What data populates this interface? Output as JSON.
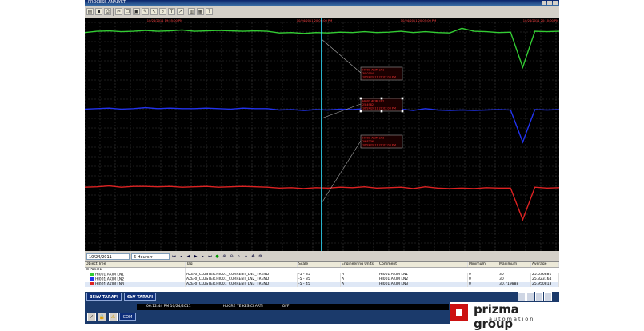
{
  "window": {
    "title": "PROCESS ANALYST"
  },
  "toolbar": {
    "icons": [
      "open-icon",
      "save-icon",
      "print-icon",
      "cut-icon",
      "copy-icon",
      "paste-icon",
      "pen-icon",
      "pointer-icon",
      "zoom-icon",
      "text-icon",
      "arrow-icon",
      "chart-icon",
      "grid-icon",
      "help-icon"
    ]
  },
  "chart": {
    "top_timestamps": [
      "10/24/2011 19:55:00 PM",
      "10/24/2011 20:00:00 PM",
      "10/24/2011 20:05:00 PM",
      "10/24/2011 20:10:00 PM"
    ],
    "cursor_labels": [
      {
        "line1": "HI001 AKIM LN1",
        "line2": "30.0704",
        "line3": "10/24/2011 20:02:00 PM"
      },
      {
        "line1": "HI001 AKIM LN2",
        "line2": "25.4982",
        "line3": "10/24/2011 20:02:00 PM"
      },
      {
        "line1": "HI001 AKIM LN3",
        "line2": "29.8236",
        "line3": "10/24/2011 20:02:00 PM"
      }
    ]
  },
  "chart_data": {
    "type": "line",
    "x": [
      0,
      1,
      2,
      3,
      4,
      5,
      6,
      7,
      8,
      9,
      10,
      11,
      12,
      13,
      14,
      15,
      16,
      17,
      18,
      19,
      20,
      21,
      22,
      23,
      24,
      25,
      26,
      27,
      28,
      29,
      30,
      31,
      32,
      33,
      34,
      35,
      36,
      37,
      38,
      39
    ],
    "series": [
      {
        "values": [
          30.6,
          30.9,
          31.0,
          30.8,
          30.9,
          31.1,
          30.9,
          31.0,
          31.2,
          30.9,
          31.0,
          31.1,
          31.0,
          30.9,
          31.0,
          30.9,
          30.5,
          30.6,
          30.4,
          30.6,
          30.5,
          30.7,
          30.6,
          30.8,
          30.6,
          30.7,
          30.9,
          30.6,
          30.8,
          30.6,
          30.5,
          31.6,
          30.9,
          30.8,
          30.6,
          30.7,
          22.4,
          30.9,
          30.8,
          30.9
        ],
        "color": "#33cc33"
      },
      {
        "values": [
          25.5,
          25.6,
          25.7,
          25.5,
          25.6,
          25.8,
          25.6,
          25.7,
          25.6,
          25.6,
          25.7,
          25.6,
          25.5,
          25.7,
          25.6,
          25.6,
          25.3,
          25.4,
          25.2,
          25.4,
          25.3,
          25.5,
          25.4,
          25.6,
          25.3,
          25.4,
          25.5,
          25.2,
          25.6,
          25.3,
          25.2,
          25.3,
          25.2,
          25.3,
          25.4,
          25.3,
          18.3,
          25.4,
          25.3,
          25.4
        ],
        "color": "#2233ee"
      },
      {
        "values": [
          30.0,
          30.1,
          30.3,
          30.0,
          30.2,
          30.2,
          30.1,
          30.2,
          30.0,
          30.1,
          30.2,
          30.0,
          30.1,
          30.2,
          30.1,
          30.0,
          29.8,
          29.9,
          29.7,
          29.9,
          29.8,
          30.0,
          29.9,
          30.1,
          29.8,
          29.9,
          30.0,
          29.7,
          30.1,
          29.8,
          29.7,
          29.8,
          29.7,
          29.9,
          29.8,
          29.8,
          22.5,
          30.0,
          29.8,
          29.9
        ],
        "color": "#dd2222"
      }
    ]
  },
  "navbar": {
    "datetime": "10/24/2011 20:09:19.957",
    "period": "6 Hours"
  },
  "grid": {
    "headers": [
      "Object Tree",
      "Tag",
      "Scale",
      "Engineering Units",
      "Comment",
      "Minimum",
      "Maximum",
      "Average"
    ],
    "tree_root": "Panel1",
    "rows": [
      {
        "name": "HI001 AKIM LN1",
        "tag": "AZERI_CLUSTER.HI001_CURRENT_LN1_TREND",
        "scale": "-5 - 35",
        "units": "A",
        "comment": "HI001 AKIM LN1",
        "min": "0",
        "max": "30",
        "avg": "25.536881",
        "color": "#33cc33"
      },
      {
        "name": "HI001 AKIM LN2",
        "tag": "AZERI_CLUSTER.HI001_CURRENT_LN2_TREND",
        "scale": "-5 - 35",
        "units": "A",
        "comment": "HI001 AKIM LN2",
        "min": "0",
        "max": "30",
        "avg": "25.323164",
        "color": "#2233ee"
      },
      {
        "name": "HI001 AKIM LN3",
        "tag": "AZERI_CLUSTER.HI001_CURRENT_LN3_TREND",
        "scale": "-5 - 45",
        "units": "A",
        "comment": "HI001 AKIM LN3",
        "min": "0",
        "max": "30.719888",
        "avg": "25.950813",
        "color": "#dd2222"
      }
    ]
  },
  "status": {
    "btn_left": "35kV TARAFI",
    "btn_right": "6kV TARAFI",
    "event_time": "06:12:44 PM 10/24/2011",
    "event_text": "HUCRE YE KESICI ARTI",
    "event_state": "OFF",
    "com_label": "COM"
  },
  "logo": {
    "name": "prizma group",
    "sub": "automation"
  }
}
